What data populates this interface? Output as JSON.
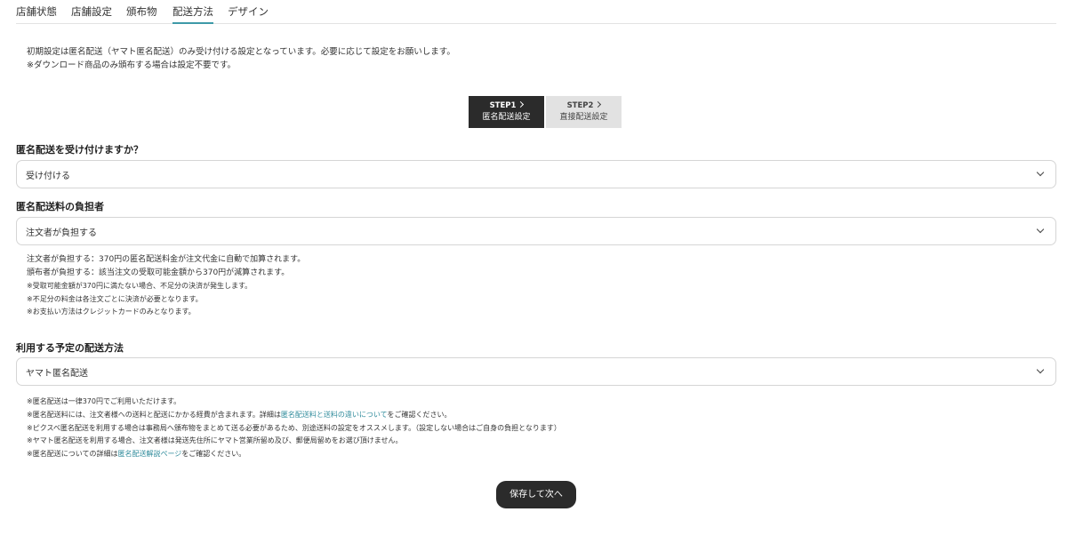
{
  "tabs": [
    {
      "label": "店舗状態"
    },
    {
      "label": "店舗設定"
    },
    {
      "label": "頒布物"
    },
    {
      "label": "配送方法",
      "active": true
    },
    {
      "label": "デザイン"
    }
  ],
  "intro": {
    "line1": "初期設定は匿名配送（ヤマト匿名配送）のみ受け付ける設定となっています。必要に応じて設定をお願いします。",
    "line2": "※ダウンロード商品のみ頒布する場合は設定不要です。"
  },
  "steps": [
    {
      "number": "STEP1",
      "label": "匿名配送設定",
      "active": true
    },
    {
      "number": "STEP2",
      "label": "直接配送設定",
      "active": false
    }
  ],
  "q1": {
    "label": "匿名配送を受け付けますか？",
    "value": "受け付ける"
  },
  "q2": {
    "label": "匿名配送料の負担者",
    "value": "注文者が負担する"
  },
  "q2_notes": {
    "line1": "注文者が負担する：370円の匿名配送料金が注文代金に自動で加算されます。",
    "line2": "頒布者が負担する：該当注文の受取可能金額から370円が減算されます。",
    "small1": "※受取可能金額が370円に満たない場合、不足分の決済が発生します。",
    "small2": "※不足分の料金は各注文ごとに決済が必要となります。",
    "small3": "※お支払い方法はクレジットカードのみとなります。"
  },
  "q3": {
    "label": "利用する予定の配送方法",
    "value": "ヤマト匿名配送"
  },
  "q3_notes": {
    "line1": "※匿名配送は一律370円でご利用いただけます。",
    "line2_pre": "※匿名配送料には、注文者様への送料と配送にかかる経費が含まれます。詳細は",
    "line2_link": "匿名配送料と送料の違いについて",
    "line2_post": "をご確認ください。",
    "line3": "※ピクスベ匿名配送を利用する場合は事務局へ頒布物をまとめて送る必要があるため、別途送料の設定をオススメします。（設定しない場合はご自身の負担となります）",
    "line4": "※ヤマト匿名配送を利用する場合、注文者様は発送先住所にヤマト営業所留め及び、郵便局留めをお選び頂けません。",
    "line5_pre": "※匿名配送についての詳細は",
    "line5_link": "匿名配送解説ページ",
    "line5_post": "をご確認ください。"
  },
  "save_button": {
    "label": "保存して次へ"
  },
  "colors": {
    "accent": "#3e9aa8",
    "link": "#2f8b9b",
    "button_dark": "#2b2b2b",
    "step_inactive": "#e2e2e2"
  }
}
